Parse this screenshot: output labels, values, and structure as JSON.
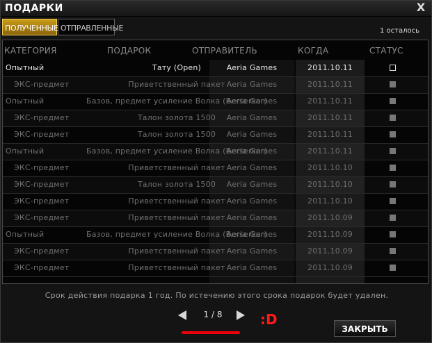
{
  "window": {
    "title": "ПОДАРКИ",
    "close_glyph": "X"
  },
  "tabs": [
    {
      "label": "ПОЛУЧЕННЫЕ",
      "active": true
    },
    {
      "label": "ОТПРАВЛЕННЫЕ",
      "active": false
    }
  ],
  "remaining": "1 осталось",
  "columns": {
    "category": "КАТЕГОРИЯ",
    "gift": "ПОДАРОК",
    "sender": "ОТПРАВИТЕЛЬ",
    "date": "КОГДА",
    "status": "СТАТУС"
  },
  "rows": [
    {
      "category": "Опытный",
      "gift": "Тату (Open)",
      "sender": "Aeria Games",
      "date": "2011.10.11",
      "status": "unclaimed",
      "selected": true,
      "sub": false
    },
    {
      "category": "ЭКС-предмет",
      "gift": "Приветственный пакет",
      "sender": "Aeria Games",
      "date": "2011.10.11",
      "status": "claimed",
      "selected": false,
      "sub": true
    },
    {
      "category": "Опытный",
      "gift": "Базов, предмет усиление Волка (Berserker)",
      "sender": "Aeria Games",
      "date": "2011.10.11",
      "status": "claimed",
      "selected": false,
      "sub": false
    },
    {
      "category": "ЭКС-предмет",
      "gift": "Талон золота 1500",
      "sender": "Aeria Games",
      "date": "2011.10.11",
      "status": "claimed",
      "selected": false,
      "sub": true
    },
    {
      "category": "ЭКС-предмет",
      "gift": "Талон золота 1500",
      "sender": "Aeria Games",
      "date": "2011.10.11",
      "status": "claimed",
      "selected": false,
      "sub": true
    },
    {
      "category": "Опытный",
      "gift": "Базов, предмет усиление Волка (Berserker)",
      "sender": "Aeria Games",
      "date": "2011.10.11",
      "status": "claimed",
      "selected": false,
      "sub": false
    },
    {
      "category": "ЭКС-предмет",
      "gift": "Приветственный пакет",
      "sender": "Aeria Games",
      "date": "2011.10.10",
      "status": "claimed",
      "selected": false,
      "sub": true
    },
    {
      "category": "ЭКС-предмет",
      "gift": "Талон золота 1500",
      "sender": "Aeria Games",
      "date": "2011.10.10",
      "status": "claimed",
      "selected": false,
      "sub": true
    },
    {
      "category": "ЭКС-предмет",
      "gift": "Приветственный пакет",
      "sender": "Aeria Games",
      "date": "2011.10.10",
      "status": "claimed",
      "selected": false,
      "sub": true
    },
    {
      "category": "ЭКС-предмет",
      "gift": "Приветственный пакет",
      "sender": "Aeria Games",
      "date": "2011.10.09",
      "status": "claimed",
      "selected": false,
      "sub": true
    },
    {
      "category": "Опытный",
      "gift": "Базов, предмет усиление Волка (Berserker)",
      "sender": "Aeria Games",
      "date": "2011.10.09",
      "status": "claimed",
      "selected": false,
      "sub": false
    },
    {
      "category": "ЭКС-предмет",
      "gift": "Приветственный пакет",
      "sender": "Aeria Games",
      "date": "2011.10.09",
      "status": "claimed",
      "selected": false,
      "sub": true
    },
    {
      "category": "ЭКС-предмет",
      "gift": "Приветственный пакет",
      "sender": "Aeria Games",
      "date": "2011.10.09",
      "status": "claimed",
      "selected": false,
      "sub": true
    }
  ],
  "note": "Срок действия подарка 1 год. По истечению этого срока подарок будет удален.",
  "pager": {
    "text": "1 / 8",
    "current": 1,
    "total": 8
  },
  "annotation": ":D",
  "close_button": "ЗАКРЫТЬ",
  "colors": {
    "accent": "#c99c1a",
    "annotation": "#ff1a1a",
    "underline": "#e8000a"
  }
}
